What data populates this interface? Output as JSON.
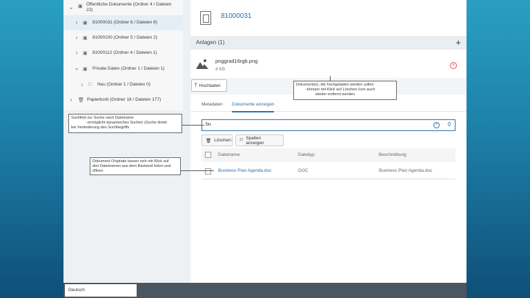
{
  "tree": {
    "items": [
      {
        "label": "Öffentliche Dokumente (Ordner 4 / Dateien",
        "label2": "22)",
        "expanded": true
      },
      {
        "label": "81000031 (Ordner 6 / Dateien 8)",
        "selected": true
      },
      {
        "label": "81000100 (Ordner 5 / Dateien 2)"
      },
      {
        "label": "81000112 (Ordner 4 / Dateien 1)"
      },
      {
        "label": "Private Daten (Ordner 1 / Dateien 1)",
        "expanded": true
      },
      {
        "label": "Neu (Ordner 1 / Dateien 0)"
      },
      {
        "label": "Papierkorb (Ordner 18 / Dateien 177)"
      }
    ]
  },
  "header": {
    "title": "81000031"
  },
  "attachments": {
    "title": "Anlagen (1)",
    "file": {
      "name": "pnggrad16rgb.png",
      "size": "4 KB"
    },
    "upload_label": "Hochladen"
  },
  "tabs": [
    {
      "label": "Metadaten",
      "active": false
    },
    {
      "label": "Dokumente anzeigen",
      "active": true
    }
  ],
  "search": {
    "value": "bu"
  },
  "toolbar": {
    "delete_label": "Löschen",
    "columns_label": "Spalten anzeigen"
  },
  "table": {
    "headers": [
      "Dateiname",
      "Dateityp",
      "Beschreibung"
    ],
    "rows": [
      {
        "name": "Business Plan Agenda.doc",
        "type": "DOC",
        "description": "Business Plan Agenda.doc"
      }
    ]
  },
  "language": {
    "selected": "Deutsch"
  },
  "callouts": {
    "upload": [
      "Dokument(e), die hochgeladen werden sollen",
      "-können mit Klick auf Löschen Icon auch",
      "wieder entfernt werden"
    ],
    "search": [
      "Suchfeld zur Suche nach Dateiname",
      "-ermöglicht dynamisches Suchen (Suche direkt",
      "bei Veränderung des Suchbegriffs"
    ],
    "open": [
      "Dokument Originale lassen sich mit Klick auf",
      "den Dateinamen aus dem Backend holen und",
      "öffnen"
    ]
  },
  "colors": {
    "accent": "#2b6ea8",
    "danger": "#e04b4b"
  }
}
